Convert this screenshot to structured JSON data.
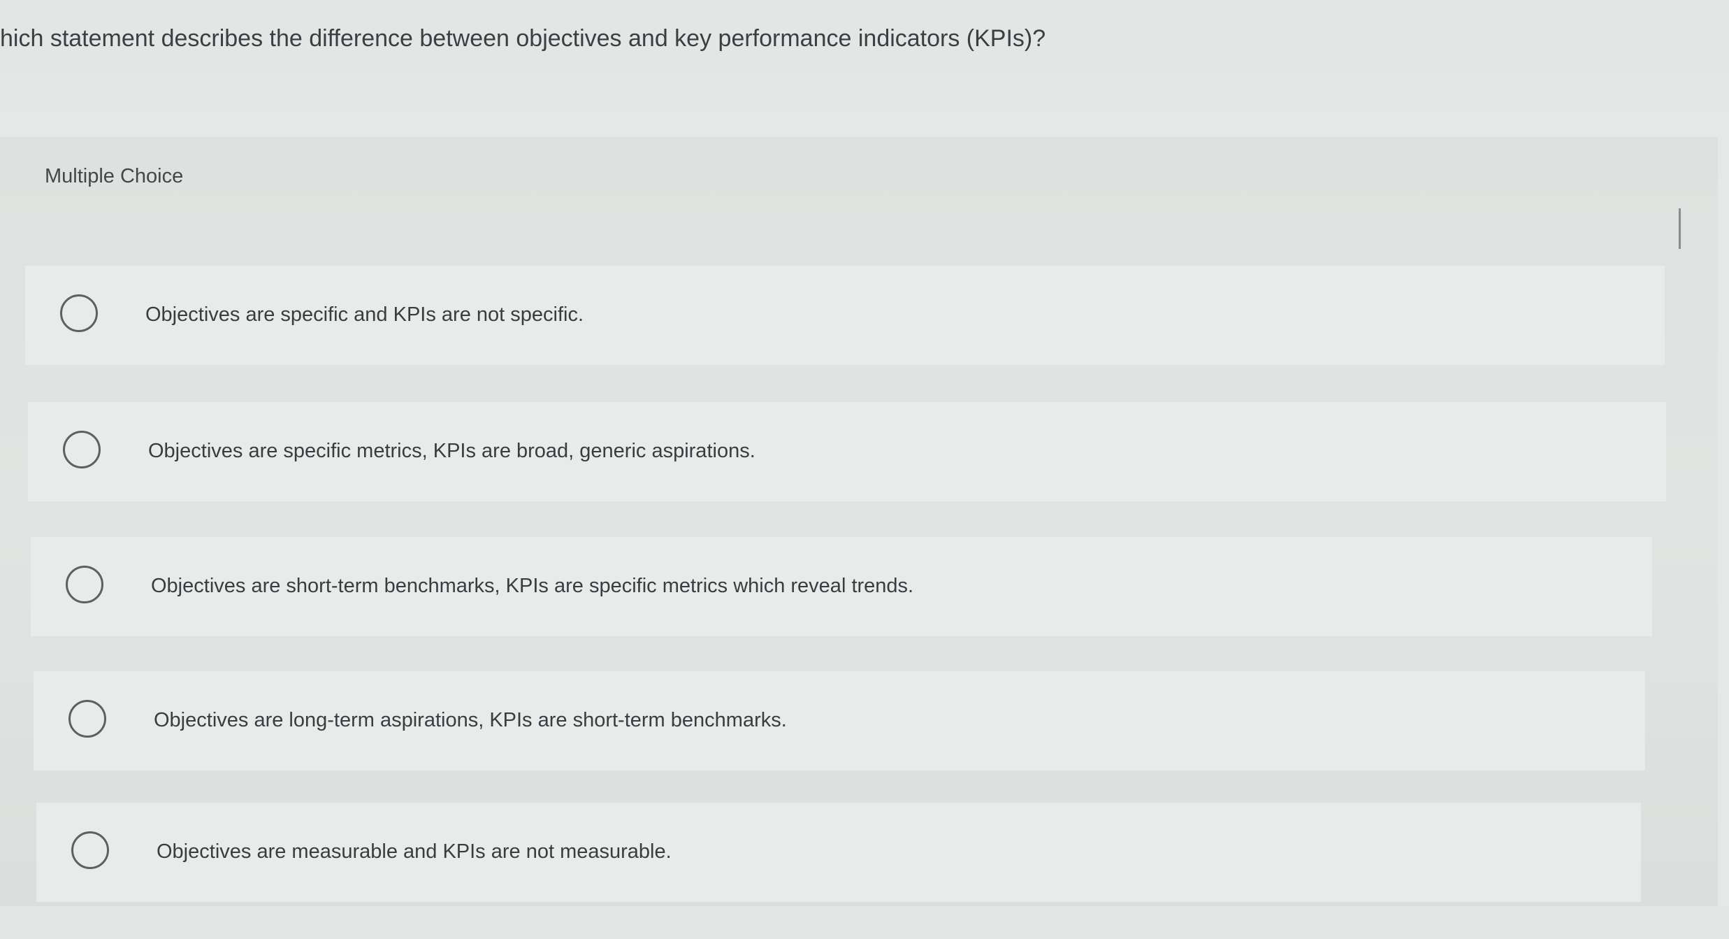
{
  "question": {
    "text": "hich statement describes the difference between objectives and key performance indicators (KPIs)?"
  },
  "panel": {
    "label": "Multiple Choice"
  },
  "options": [
    {
      "label": "Objectives are specific and KPIs are not specific.",
      "selected": false
    },
    {
      "label": "Objectives are specific metrics, KPIs are broad, generic aspirations.",
      "selected": false
    },
    {
      "label": "Objectives are short-term benchmarks, KPIs are specific metrics which reveal trends.",
      "selected": false
    },
    {
      "label": "Objectives are long-term aspirations, KPIs are short-term benchmarks.",
      "selected": false
    },
    {
      "label": "Objectives are measurable and KPIs are not measurable.",
      "selected": false
    }
  ],
  "icons": {
    "radio": "radio-unchecked-icon"
  },
  "colors": {
    "background": "#e6e8e7",
    "option_background": "#e9ebea",
    "text": "#3a3d40",
    "radio_border": "#5d6063"
  }
}
